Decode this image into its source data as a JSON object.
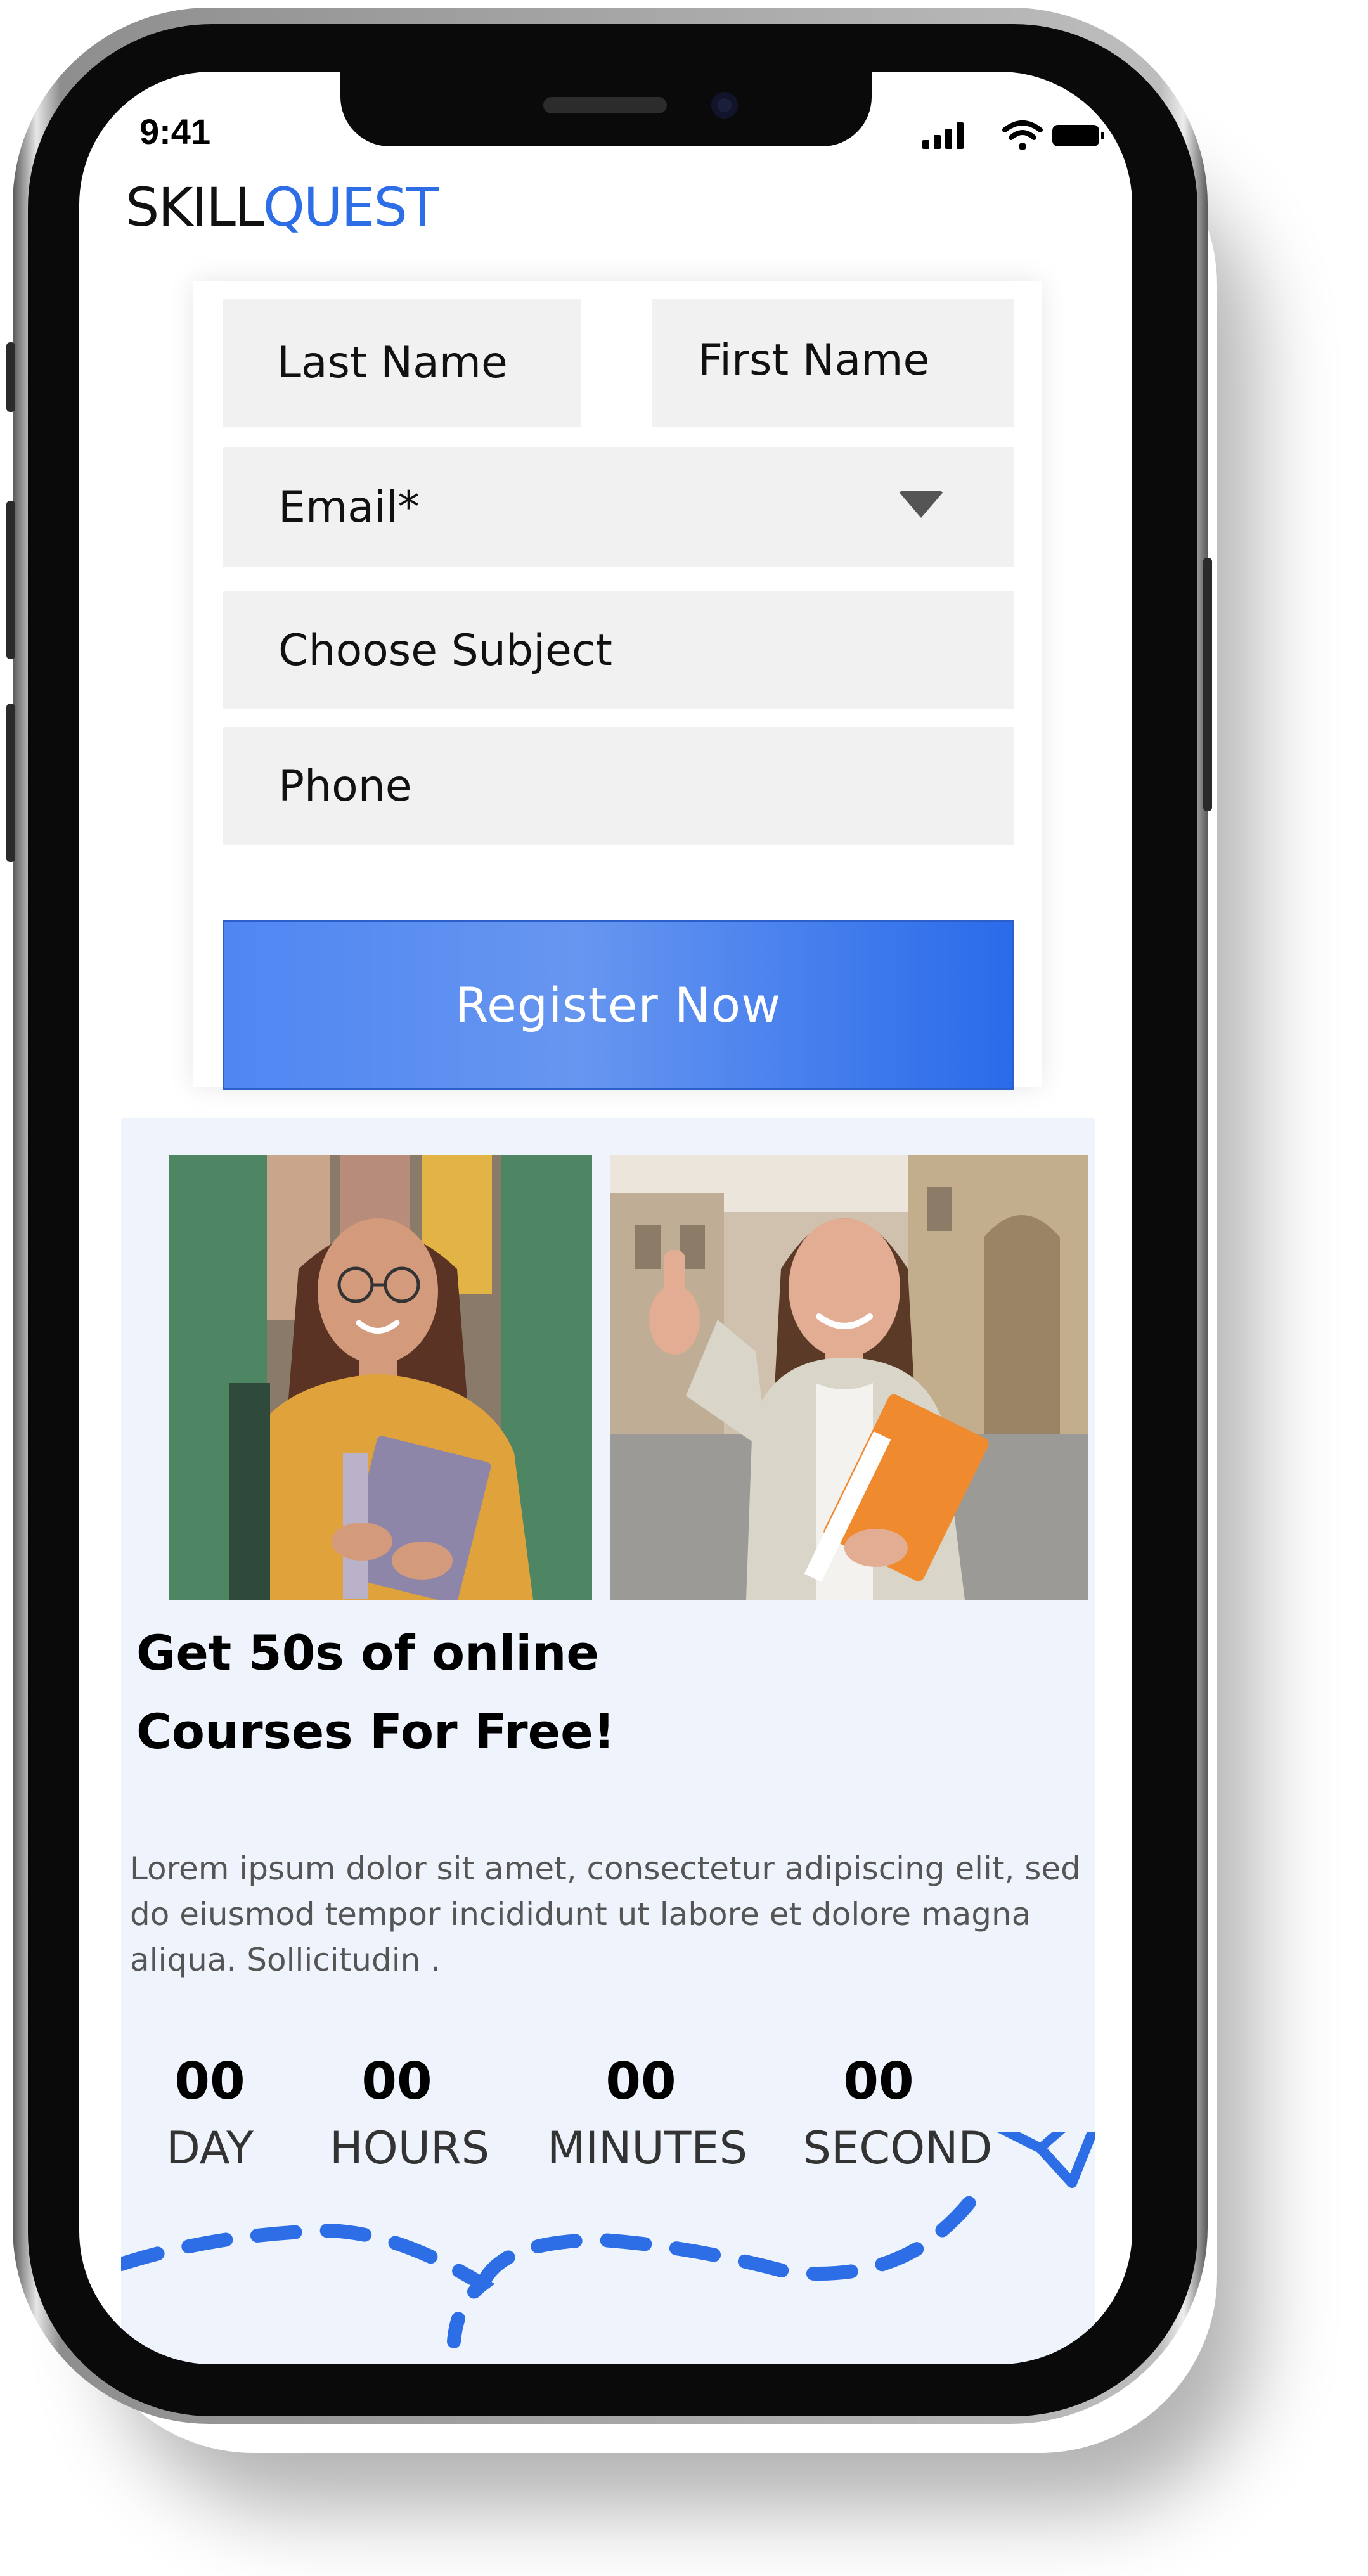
{
  "status_bar": {
    "time": "9:41"
  },
  "brand": {
    "part1": "SKILL",
    "part2": "QUEST",
    "accent_color": "#2d6ee6"
  },
  "form": {
    "last_name_label": "Last Name",
    "first_name_label": "First Name",
    "email_label": "Email*",
    "subject_label": "Choose Subject",
    "phone_label": "Phone",
    "register_label": "Register Now",
    "button_color": "#4f86f2"
  },
  "promo": {
    "headline_line1": "Get 50s of online",
    "headline_line2": "Courses For Free!",
    "body": "Lorem ipsum dolor sit amet, consectetur adipiscing elit, sed do eiusmod tempor incididunt ut labore et dolore magna aliqua. Sollicitudin .",
    "background": "#eef3fc",
    "countdown": [
      {
        "value": "00",
        "label": "DAY"
      },
      {
        "value": "00",
        "label": "HOURS"
      },
      {
        "value": "00",
        "label": "MINUTES"
      },
      {
        "value": "00",
        "label": "SECOND"
      }
    ],
    "icons": [
      "paper-plane-icon"
    ]
  }
}
